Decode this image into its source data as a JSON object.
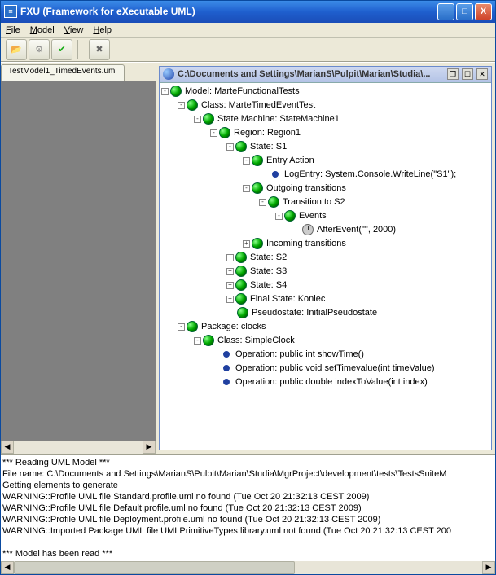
{
  "window": {
    "title": "FXU (Framework for eXecutable UML)",
    "icon_glyph": "≡"
  },
  "win_buttons": {
    "min": "_",
    "max": "□",
    "close": "X"
  },
  "menu": {
    "file": "File",
    "model": "Model",
    "view": "View",
    "help": "Help"
  },
  "toolbar_icons": {
    "open": "📂",
    "gear": "⚙",
    "check": "✔",
    "stop": "✖"
  },
  "left_tab": "TestModel1_TimedEvents.uml",
  "inner_title": "C:\\Documents and Settings\\MarianS\\Pulpit\\Marian\\Studia\\...",
  "inner_buttons": {
    "restore": "❐",
    "max": "☐",
    "close": "✕"
  },
  "tree": [
    {
      "d": 0,
      "t": "-",
      "i": "sphere",
      "l": "Model: MarteFunctionalTests"
    },
    {
      "d": 1,
      "t": "-",
      "i": "sphere",
      "l": "Class: MarteTimedEventTest"
    },
    {
      "d": 2,
      "t": "-",
      "i": "sphere",
      "l": "State Machine: StateMachine1"
    },
    {
      "d": 3,
      "t": "-",
      "i": "sphere",
      "l": "Region: Region1"
    },
    {
      "d": 4,
      "t": "-",
      "i": "sphere",
      "l": "State: S1"
    },
    {
      "d": 5,
      "t": "-",
      "i": "sphere",
      "l": "Entry Action"
    },
    {
      "d": 6,
      "t": "",
      "i": "dot",
      "l": "LogEntry: System.Console.WriteLine(\"S1\");"
    },
    {
      "d": 5,
      "t": "-",
      "i": "sphere",
      "l": "Outgoing transitions"
    },
    {
      "d": 6,
      "t": "-",
      "i": "sphere",
      "l": "Transition to S2"
    },
    {
      "d": 7,
      "t": "-",
      "i": "sphere",
      "l": "Events"
    },
    {
      "d": 8,
      "t": "",
      "i": "clock",
      "l": "AfterEvent(\"\", 2000)"
    },
    {
      "d": 5,
      "t": "+",
      "i": "sphere",
      "l": "Incoming transitions"
    },
    {
      "d": 4,
      "t": "+",
      "i": "sphere",
      "l": "State: S2"
    },
    {
      "d": 4,
      "t": "+",
      "i": "sphere",
      "l": "State: S3"
    },
    {
      "d": 4,
      "t": "+",
      "i": "sphere",
      "l": "State: S4"
    },
    {
      "d": 4,
      "t": "+",
      "i": "sphere",
      "l": "Final State: Koniec"
    },
    {
      "d": 4,
      "t": "",
      "i": "sphere",
      "l": "Pseudostate: InitialPseudostate"
    },
    {
      "d": 1,
      "t": "-",
      "i": "sphere",
      "l": "Package: clocks"
    },
    {
      "d": 2,
      "t": "-",
      "i": "sphere",
      "l": "Class: SimpleClock"
    },
    {
      "d": 3,
      "t": "",
      "i": "dot",
      "l": "Operation: public int showTime()"
    },
    {
      "d": 3,
      "t": "",
      "i": "dot",
      "l": "Operation: public void setTimevalue(int timeValue)"
    },
    {
      "d": 3,
      "t": "",
      "i": "dot",
      "l": "Operation: public double indexToValue(int index)"
    }
  ],
  "messages": [
    "*** Reading UML Model ***",
    "File name: C:\\Documents and Settings\\MarianS\\Pulpit\\Marian\\Studia\\MgrProject\\development\\tests\\TestsSuiteM",
    "Getting elements to generate",
    "WARNING::Profile UML file Standard.profile.uml no found (Tue Oct 20 21:32:13 CEST 2009)",
    "WARNING::Profile UML file Default.profile.uml no found (Tue Oct 20 21:32:13 CEST 2009)",
    "WARNING::Profile UML file Deployment.profile.uml no found (Tue Oct 20 21:32:13 CEST 2009)",
    "WARNING::Imported Package UML file UMLPrimitiveTypes.library.uml not found (Tue Oct 20 21:32:13 CEST 200",
    "",
    "*** Model has been read ***"
  ],
  "scroll_glyphs": {
    "left": "◀",
    "right": "▶"
  }
}
